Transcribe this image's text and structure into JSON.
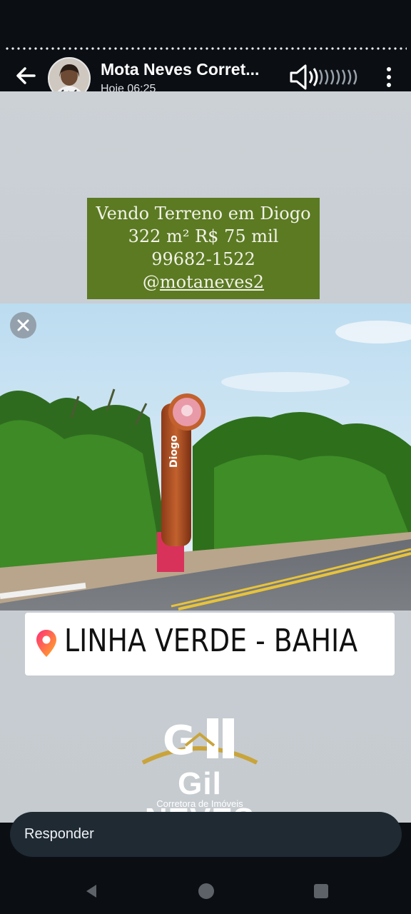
{
  "header": {
    "contact_name": "Mota Neves Corret...",
    "timestamp": "Hoje 06:25"
  },
  "story": {
    "headline": {
      "line1": "Vendo Terreno em Diogo",
      "line2": "322 m² R$ 75 mil",
      "line3": "99682-1522",
      "line4_prefix": "@",
      "line4_handle": "motaneves2"
    },
    "sign_label": "Diogo",
    "location_label": "LINHA VERDE - BAHIA",
    "brand": {
      "name": "Gil NEVES",
      "tagline": "Corretora de Imóveis"
    }
  },
  "reply": {
    "label": "Responder"
  },
  "colors": {
    "headline_bg": "#5b7a22",
    "reply_bar_bg": "#1f2a33",
    "pin_gradient_start": "#ff2d7a",
    "pin_gradient_end": "#ffb020"
  },
  "icons": {
    "back": "arrow-left-icon",
    "sound": "speaker-icon",
    "menu": "more-vert-icon",
    "close": "close-icon",
    "location": "location-pin-icon"
  }
}
